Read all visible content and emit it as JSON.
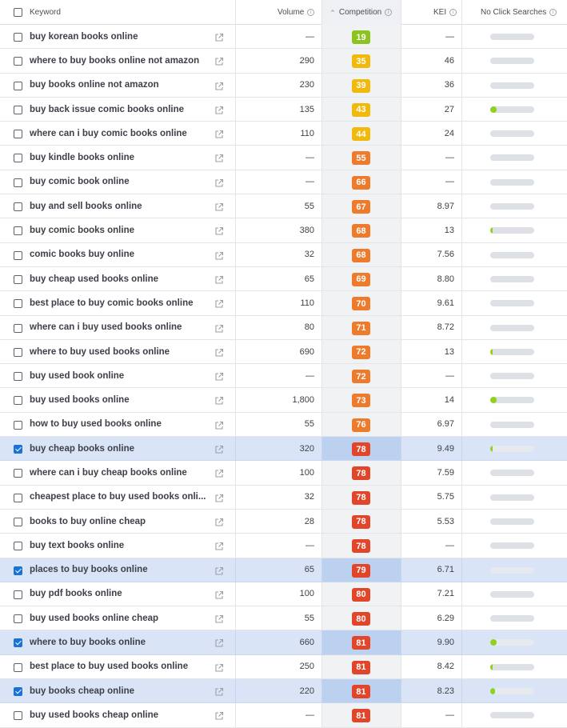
{
  "header": {
    "keyword_label": "Keyword",
    "volume_label": "Volume",
    "competition_label": "Competition",
    "kei_label": "KEI",
    "no_click_label": "No Click Searches",
    "sort_indicator": "^",
    "info_glyph": "i"
  },
  "colors": {
    "green": "#8cc31f",
    "yellow": "#f0b90b",
    "orange": "#ee7a2c",
    "red": "#e1462b",
    "checkbox_accent": "#1a73d4"
  },
  "icons": {
    "external_link": "external-link-icon",
    "info": "info-icon",
    "sort": "sort-up-icon"
  },
  "rows": [
    {
      "keyword": "buy korean books online",
      "volume": "—",
      "competition": "19",
      "kei": "—",
      "no_click": 0,
      "checked": false
    },
    {
      "keyword": "where to buy books online not amazon",
      "volume": "290",
      "competition": "35",
      "kei": "46",
      "no_click": 0,
      "checked": false
    },
    {
      "keyword": "buy books online not amazon",
      "volume": "230",
      "competition": "39",
      "kei": "36",
      "no_click": 0,
      "checked": false
    },
    {
      "keyword": "buy back issue comic books online",
      "volume": "135",
      "competition": "43",
      "kei": "27",
      "no_click": 0.15,
      "checked": false
    },
    {
      "keyword": "where can i buy comic books online",
      "volume": "110",
      "competition": "44",
      "kei": "24",
      "no_click": 0,
      "checked": false
    },
    {
      "keyword": "buy kindle books online",
      "volume": "—",
      "competition": "55",
      "kei": "—",
      "no_click": 0,
      "checked": false
    },
    {
      "keyword": "buy comic book online",
      "volume": "—",
      "competition": "66",
      "kei": "—",
      "no_click": 0,
      "checked": false
    },
    {
      "keyword": "buy and sell books online",
      "volume": "55",
      "competition": "67",
      "kei": "8.97",
      "no_click": 0,
      "checked": false
    },
    {
      "keyword": "buy comic books online",
      "volume": "380",
      "competition": "68",
      "kei": "13",
      "no_click": 0.06,
      "checked": false
    },
    {
      "keyword": "comic books buy online",
      "volume": "32",
      "competition": "68",
      "kei": "7.56",
      "no_click": 0,
      "checked": false
    },
    {
      "keyword": "buy cheap used books online",
      "volume": "65",
      "competition": "69",
      "kei": "8.80",
      "no_click": 0,
      "checked": false
    },
    {
      "keyword": "best place to buy comic books online",
      "volume": "110",
      "competition": "70",
      "kei": "9.61",
      "no_click": 0,
      "checked": false
    },
    {
      "keyword": "where can i buy used books online",
      "volume": "80",
      "competition": "71",
      "kei": "8.72",
      "no_click": 0,
      "checked": false
    },
    {
      "keyword": "where to buy used books online",
      "volume": "690",
      "competition": "72",
      "kei": "13",
      "no_click": 0.06,
      "checked": false
    },
    {
      "keyword": "buy used book online",
      "volume": "—",
      "competition": "72",
      "kei": "—",
      "no_click": 0,
      "checked": false
    },
    {
      "keyword": "buy used books online",
      "volume": "1,800",
      "competition": "73",
      "kei": "14",
      "no_click": 0.15,
      "checked": false
    },
    {
      "keyword": "how to buy used books online",
      "volume": "55",
      "competition": "76",
      "kei": "6.97",
      "no_click": 0,
      "checked": false
    },
    {
      "keyword": "buy cheap books online",
      "volume": "320",
      "competition": "78",
      "kei": "9.49",
      "no_click": 0.06,
      "checked": true
    },
    {
      "keyword": "where can i buy cheap books online",
      "volume": "100",
      "competition": "78",
      "kei": "7.59",
      "no_click": 0,
      "checked": false
    },
    {
      "keyword": "cheapest place to buy used books onli...",
      "volume": "32",
      "competition": "78",
      "kei": "5.75",
      "no_click": 0,
      "checked": false
    },
    {
      "keyword": "books to buy online cheap",
      "volume": "28",
      "competition": "78",
      "kei": "5.53",
      "no_click": 0,
      "checked": false
    },
    {
      "keyword": "buy text books online",
      "volume": "—",
      "competition": "78",
      "kei": "—",
      "no_click": 0,
      "checked": false
    },
    {
      "keyword": "places to buy books online",
      "volume": "65",
      "competition": "79",
      "kei": "6.71",
      "no_click": 0,
      "checked": true
    },
    {
      "keyword": "buy pdf books online",
      "volume": "100",
      "competition": "80",
      "kei": "7.21",
      "no_click": 0,
      "checked": false
    },
    {
      "keyword": "buy used books online cheap",
      "volume": "55",
      "competition": "80",
      "kei": "6.29",
      "no_click": 0,
      "checked": false
    },
    {
      "keyword": "where to buy books online",
      "volume": "660",
      "competition": "81",
      "kei": "9.90",
      "no_click": 0.15,
      "checked": true
    },
    {
      "keyword": "best place to buy used books online",
      "volume": "250",
      "competition": "81",
      "kei": "8.42",
      "no_click": 0.06,
      "checked": false
    },
    {
      "keyword": "buy books cheap online",
      "volume": "220",
      "competition": "81",
      "kei": "8.23",
      "no_click": 0.1,
      "checked": true
    },
    {
      "keyword": "buy used books cheap online",
      "volume": "—",
      "competition": "81",
      "kei": "—",
      "no_click": 0,
      "checked": false
    }
  ]
}
